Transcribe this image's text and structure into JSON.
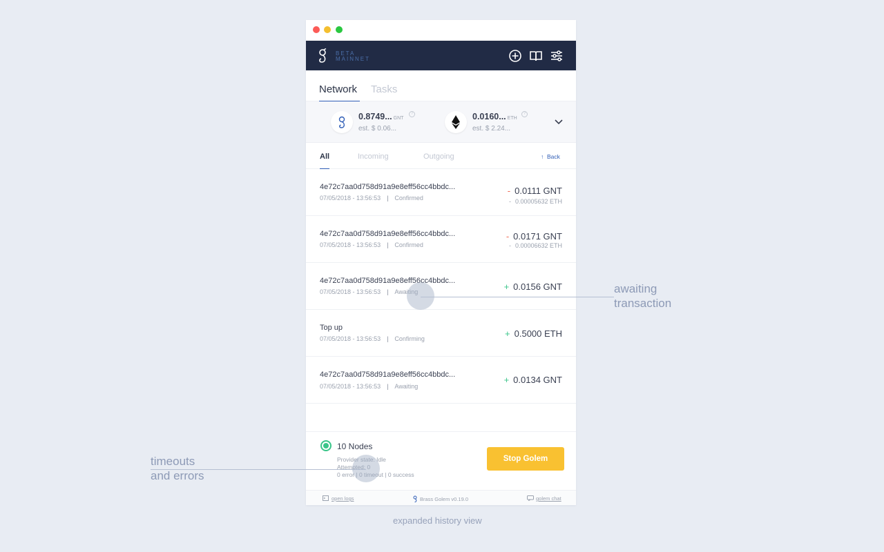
{
  "app": {
    "brand_line1": "BETA",
    "brand_line2": "MAINNET"
  },
  "header_icons": [
    "plus-circle-icon",
    "book-icon",
    "sliders-icon"
  ],
  "tabs": [
    {
      "label": "Network",
      "active": true
    },
    {
      "label": "Tasks",
      "active": false
    }
  ],
  "wallet": {
    "gnt": {
      "value": "0.8749...",
      "unit": "GNT",
      "est": "est. $ 0.06..."
    },
    "eth": {
      "value": "0.0160...",
      "unit": "ETH",
      "est": "est. $ 2.24..."
    }
  },
  "filters": {
    "all": "All",
    "incoming": "Incoming",
    "outgoing": "Outgoing",
    "back": "Back"
  },
  "transactions": [
    {
      "title": "4e72c7aa0d758d91a9e8eff56cc4bbdc...",
      "date": "07/05/2018 - 13:56:53",
      "sep": "|",
      "status": "Confirmed",
      "sign": "-",
      "amount": "0.0111 GNT",
      "sub_sign": "-",
      "sub_amount": "0.00005632 ETH"
    },
    {
      "title": "4e72c7aa0d758d91a9e8eff56cc4bbdc...",
      "date": "07/05/2018 - 13:56:53",
      "sep": "|",
      "status": "Confirmed",
      "sign": "-",
      "amount": "0.0171 GNT",
      "sub_sign": "-",
      "sub_amount": "0.00006632 ETH"
    },
    {
      "title": "4e72c7aa0d758d91a9e8eff56cc4bbdc...",
      "date": "07/05/2018 - 13:56:53",
      "sep": "|",
      "status": "Awaiting",
      "sign": "+",
      "amount": "0.0156 GNT"
    },
    {
      "title": "Top up",
      "date": "07/05/2018 - 13:56:53",
      "sep": "|",
      "status": "Confirming",
      "sign": "+",
      "amount": "0.5000 ETH"
    },
    {
      "title": "4e72c7aa0d758d91a9e8eff56cc4bbdc...",
      "date": "07/05/2018 - 13:56:53",
      "sep": "|",
      "status": "Awaiting",
      "sign": "+",
      "amount": "0.0134 GNT"
    }
  ],
  "status": {
    "nodes": "10 Nodes",
    "provider_state": "Provider state: Idle",
    "attempted": "Attempted: 0",
    "results": "0 error | 0 timeout | 0 success",
    "stop_label": "Stop Golem"
  },
  "bottom_bar": {
    "logs": "open logs",
    "version": "Brass Golem v0.19.0",
    "chat": "golem chat"
  },
  "annotations": {
    "awaiting_line1": "awaiting",
    "awaiting_line2": "transaction",
    "timeouts_line1": "timeouts",
    "timeouts_line2": "and errors",
    "caption": "expanded history view"
  },
  "colors": {
    "header_bg": "#212b45",
    "accent_blue": "#2f5db6",
    "stop_button": "#f9c131",
    "positive": "#3ac589",
    "negative": "#ef6a54"
  }
}
